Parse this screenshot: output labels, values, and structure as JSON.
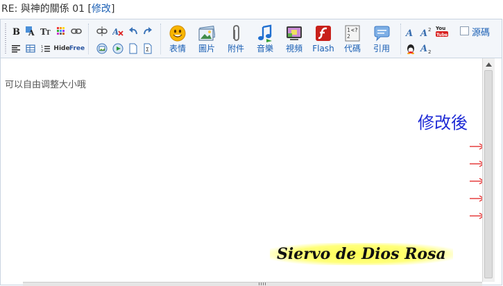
{
  "title": {
    "text": "RE: 與神的關係 01 ",
    "edit_open": "[",
    "edit_label": "修改",
    "edit_close": "]"
  },
  "toolbar": {
    "small_row1": [
      "bold-icon",
      "highlight-icon",
      "font-size-icon",
      "color-grid-icon",
      "link-icon",
      "unlink-icon",
      "clear-format-icon",
      "undo-icon",
      "redo-icon"
    ],
    "small_row2": [
      "align-left-icon",
      "table-icon",
      "list-icon",
      "hide-icon",
      "free-icon",
      "image-icon",
      "media-icon",
      "page-icon",
      "formula-icon"
    ],
    "hide_label": "Hide",
    "free_label": "Free",
    "big_buttons": [
      {
        "name": "emoticon",
        "label": "表情"
      },
      {
        "name": "image",
        "label": "圖片"
      },
      {
        "name": "attachment",
        "label": "附件"
      },
      {
        "name": "music",
        "label": "音樂"
      },
      {
        "name": "video",
        "label": "視頻"
      },
      {
        "name": "flash",
        "label": "Flash"
      },
      {
        "name": "code",
        "label": "代碼"
      },
      {
        "name": "quote",
        "label": "引用"
      }
    ],
    "source_label": "源碼",
    "youtube_label": "You Tube"
  },
  "content": {
    "body_text": "可以自由调整大小哦",
    "after_label": "修改後",
    "signature": "Siervo de Dios Rosa"
  },
  "colors": {
    "link": "#1a5fb4",
    "after_label": "#1f2bd6",
    "arrow": "#e01818",
    "signature_glow": "#ffff55"
  }
}
